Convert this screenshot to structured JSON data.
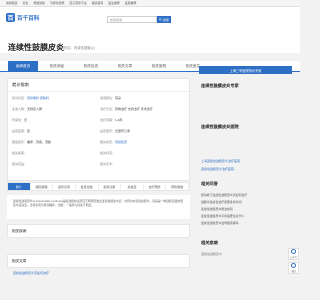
{
  "topnav": [
    "健康频道",
    "养生",
    "母婴健康",
    "可视化智能",
    "孩子营养不良",
    "疾病百科",
    "医生推荐",
    "医院推荐"
  ],
  "header": {
    "logo_mark": "百",
    "logo_text": "百千百科",
    "search_placeholder": "搜索疾病",
    "search_button": "搜索"
  },
  "title": {
    "main": "连续性鼓膜皮炎",
    "alias": "(别名：肉芽性鼓膜炎)"
  },
  "tabs": [
    "疾病首页",
    "相关病症",
    "相关检查",
    "相关文章",
    "相关医院",
    "相关医生"
  ],
  "overview": {
    "heading": "就诊指南",
    "rows_left": [
      {
        "label": "就诊科室：",
        "value": "耳鼻喉科 皮肤科"
      },
      {
        "label": "多发人群：",
        "value": "无特定人群"
      },
      {
        "label": "传染性：",
        "value": "无"
      },
      {
        "label": "是否医保：",
        "value": "否"
      },
      {
        "label": "典型症状：",
        "value": "瘙痒、耳痛、流脓"
      },
      {
        "label": "相关疾病：",
        "value": ""
      },
      {
        "label": "相关药品：",
        "value": ""
      }
    ],
    "rows_right": [
      {
        "label": "发病部位：",
        "value": "耳朵"
      },
      {
        "label": "治疗方法：",
        "value": "药物治疗 支持治疗 手术治疗"
      },
      {
        "label": "治疗周期：",
        "value": "1-2周"
      },
      {
        "label": "是否遗传：",
        "value": "无遗传几率"
      },
      {
        "label": "相关检查：",
        "value": "耳镜检查"
      },
      {
        "label": "相关科室：",
        "value": ""
      },
      {
        "label": "相关手术：",
        "value": ""
      }
    ]
  },
  "subnav": [
    "简介",
    "病因病理",
    "症状表现",
    "检查化验",
    "鉴别诊断",
    "并发症",
    "治疗预防",
    "预防保健"
  ],
  "intro_text": "连续性鼓膜皮炎(constelmatitis continua)是指鼓膜的表皮层不明原因发生连续性慢性炎症，也称为肉芽性鼓膜炎。该病是一种鼓膜表面的慢性炎症病变。患者表现为耳部瘙痒、流脓，一般听力损失不明显。",
  "related_articles": {
    "heading": "相关疾病"
  },
  "related_video": {
    "heading": "相关文章"
  },
  "article_link": "连续性鼓膜皮炎该如何治疗",
  "sidebar": {
    "consult_button": "上海三甲医院特约专家",
    "expert_title": "连续性鼓膜皮炎专家",
    "hospital_title": "连续性鼓膜皮炎医院",
    "hospital_link_1": "上海连续性鼓膜皮炎治疗医院",
    "hospital_link_2": "连续性鼓膜皮炎治疗医院",
    "qa_title": "相关问答",
    "qa_items": [
      "想请教下连续性鼓膜皮炎该如何治疗",
      "鼓膜炎连续性治疗需要多长时间",
      "连续性鼓膜皮炎能治愈吗",
      "连续性鼓膜皮炎平时需要注意什么",
      "连续性鼓膜皮炎会导致耳聋吗"
    ],
    "doctor_title": "相关疾病",
    "doctor_text": "连续性鼓膜皮炎"
  },
  "float": [
    "公众号",
    "返回"
  ]
}
